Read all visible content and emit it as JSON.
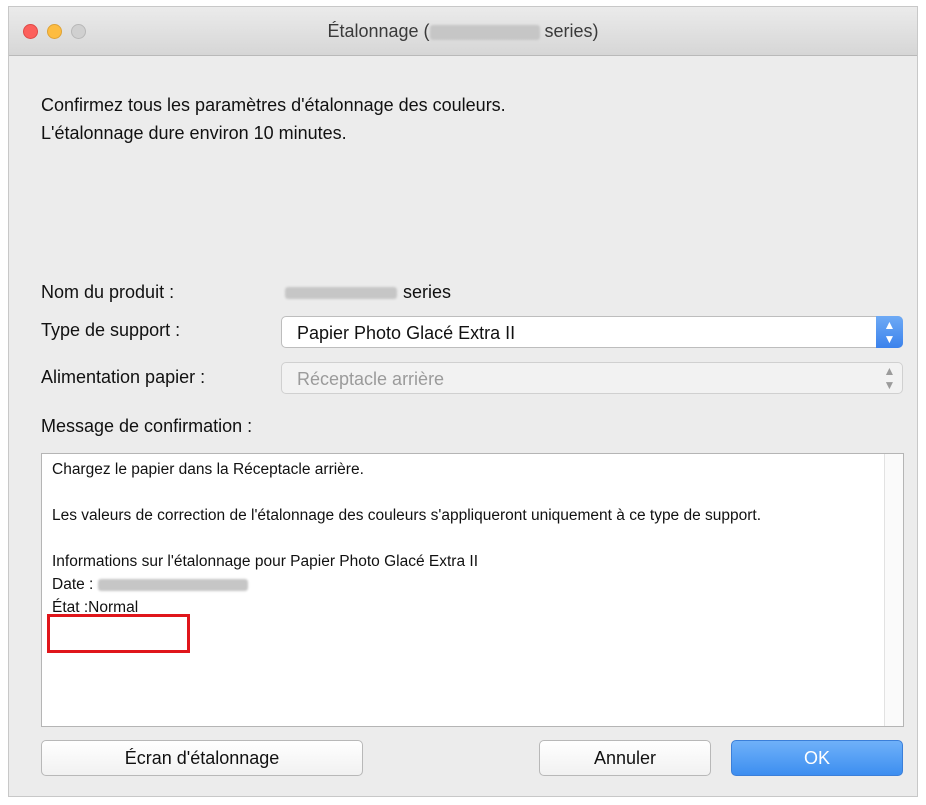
{
  "window": {
    "title_prefix": "Étalonnage (",
    "title_suffix": " series)"
  },
  "intro": {
    "line1": "Confirmez tous les paramètres d'étalonnage des couleurs.",
    "line2": "L'étalonnage dure environ 10 minutes."
  },
  "form": {
    "product_label": "Nom du produit :",
    "product_value_suffix": "series",
    "media_label": "Type de support :",
    "media_value": "Papier Photo Glacé Extra II",
    "feed_label": "Alimentation papier :",
    "feed_value": "Réceptacle arrière",
    "message_label": "Message de confirmation :"
  },
  "message": {
    "line1": "Chargez le papier dans la Réceptacle arrière.",
    "line2": "Les valeurs de correction de l'étalonnage des couleurs s'appliqueront uniquement à ce type de support.",
    "line3": "Informations sur l'étalonnage pour Papier Photo Glacé Extra II",
    "date_label": "Date :",
    "state": "État :Normal"
  },
  "buttons": {
    "calibration_screen": "Écran d'étalonnage",
    "cancel": "Annuler",
    "ok": "OK"
  },
  "icons": {
    "select_arrows": "up-down-chevron-icon"
  },
  "colors": {
    "accent": "#3d8ef0",
    "highlight": "#e0161b"
  }
}
